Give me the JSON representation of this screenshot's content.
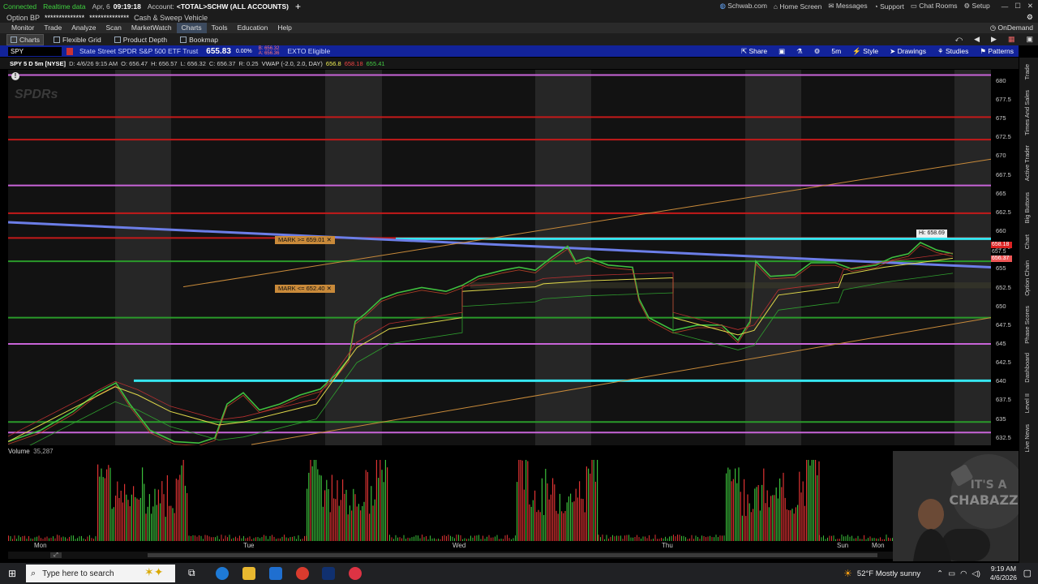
{
  "status": {
    "connection": "Connected",
    "data_mode": "Realtime data",
    "date": "Apr, 6",
    "time": "09:19:18",
    "account_label": "Account:",
    "account": "<TOTAL>SCHW (ALL ACCOUNTS)",
    "option_bp": "Option BP",
    "option_bp_value": "**************",
    "cash_sweep_value": "**************",
    "cash_sweep": "Cash & Sweep Vehicle"
  },
  "top_links": {
    "schwab": "Schwab.com",
    "home": "Home Screen",
    "messages": "Messages",
    "support": "Support",
    "chat": "Chat Rooms",
    "setup": "Setup"
  },
  "menu": [
    "Monitor",
    "Trade",
    "Analyze",
    "Scan",
    "MarketWatch",
    "Charts",
    "Tools",
    "Education",
    "Help"
  ],
  "ondemand": "OnDemand",
  "subtabs": [
    "Charts",
    "Flexible Grid",
    "Product Depth",
    "Bookmap"
  ],
  "toolbar": {
    "symbol": "SPY",
    "description": "State Street SPDR S&P 500 ETF Trust",
    "last": "655.83",
    "pct": "0.00%",
    "bid": "B: 656.32",
    "ask": "A: 656.36",
    "exto": "EXTO Eligible",
    "share": "Share",
    "interval": "5m",
    "style": "Style",
    "drawings": "Drawings",
    "studies": "Studies",
    "patterns": "Patterns"
  },
  "quote": {
    "title": "SPY 5 D 5m [NYSE]",
    "date": "D: 4/6/26 9:15 AM",
    "open": "O: 656.47",
    "high": "H: 656.57",
    "low": "L: 656.32",
    "close": "C: 656.37",
    "range": "R: 0.25",
    "vwap": "VWAP (-2.0, 2.0, DAY)",
    "v1": "656.8",
    "v2": "658.18",
    "v3": "655.41"
  },
  "chart_data": {
    "type": "line",
    "price_ticks": [
      "680",
      "677.5",
      "675",
      "672.5",
      "670",
      "667.5",
      "665",
      "662.5",
      "660",
      "657.5",
      "655",
      "652.5",
      "650",
      "647.5",
      "645",
      "642.5",
      "640",
      "637.5",
      "635",
      "632.5"
    ],
    "price_range": [
      631.5,
      681.5
    ],
    "day_labels": [
      "Mon",
      "Tue",
      "Wed",
      "Thu",
      "Sun",
      "Mon"
    ],
    "marks": [
      {
        "label": "MARK >= 659.01",
        "price": 659.01
      },
      {
        "label": "MARK <= 652.40",
        "price": 652.4
      }
    ],
    "high_label": "Hi: 658.69",
    "right_prices": [
      "658.18",
      "657.5",
      "656.37"
    ],
    "levels": {
      "magenta": [
        680.8,
        666.1,
        645.0,
        633.2
      ],
      "red": [
        675.2,
        672.2,
        662.4,
        659.1
      ],
      "green": [
        656.0,
        648.5,
        634.6
      ],
      "cyan": [
        659.0,
        640.1
      ]
    },
    "colors": {
      "magenta": "#c864d8",
      "red": "#c41a1a",
      "green": "#2a9a2a",
      "cyan": "#36e6f0",
      "blue": "#6c7ee8",
      "orange": "#c88a3a"
    }
  },
  "volume": {
    "label": "Volume",
    "value": "35,287"
  },
  "side_tabs": [
    "Trade",
    "Times And Sales",
    "Active Trader",
    "Big Buttons",
    "Chart",
    "Option Chain",
    "Phase Scores",
    "Dashboard",
    "Level II",
    "Live News"
  ],
  "taskbar": {
    "search": "Type here to search",
    "weather": "52°F  Mostly sunny",
    "time": "9:19 AM",
    "date": "4/6/2026"
  },
  "webcam": {
    "text": "IT'S A CHABAZZ"
  }
}
